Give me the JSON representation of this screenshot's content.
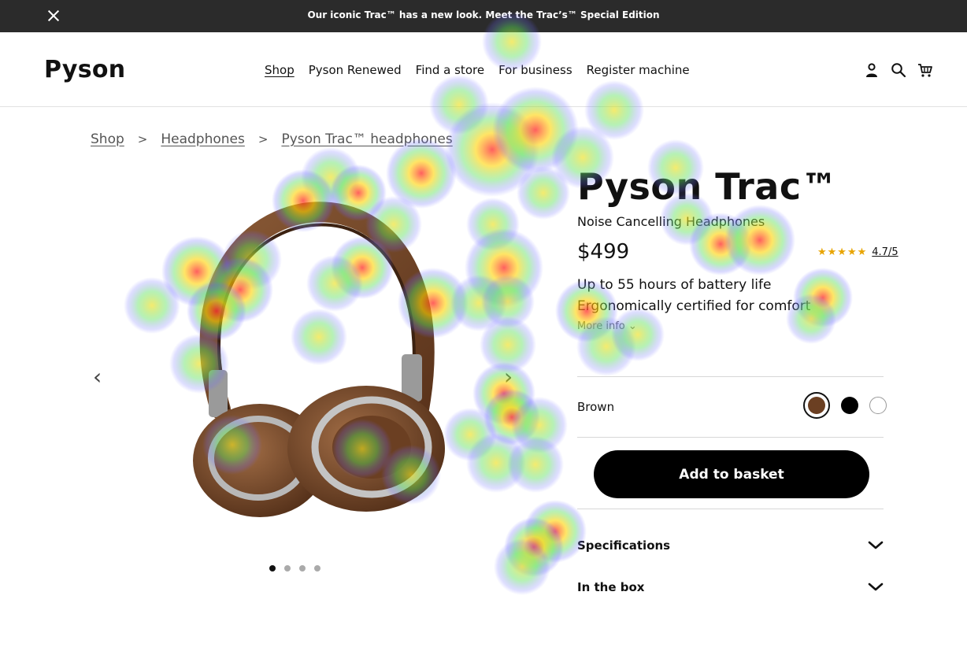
{
  "announcement": {
    "message": "Our iconic Trac™ has a new look. Meet the Trac’s™ Special Edition",
    "close_icon": "close-icon"
  },
  "header": {
    "logo": "Pyson",
    "nav": [
      "Shop",
      "Pyson Renewed",
      "Find a store",
      "For business",
      "Register machine"
    ],
    "icons": [
      "account-icon",
      "search-icon",
      "cart-icon"
    ]
  },
  "breadcrumb": [
    "Shop",
    "Headphones",
    "Pyson Trac™ headphones"
  ],
  "gallery": {
    "prev": "‹",
    "next": "›",
    "slide_count": 4,
    "active_slide": 1
  },
  "product": {
    "title": "Pyson Trac™",
    "subtitle": "Noise Cancelling Headphones",
    "price": "$499",
    "rating_stars": "★★★★★",
    "rating": "4.7/5",
    "features": [
      "Up to 55 hours of battery life",
      "Ergonomically certified for comfort"
    ],
    "more_info": "More info ⌄",
    "color_name": "Brown",
    "colors": [
      "#6b3f22",
      "#000000",
      "#ffffff"
    ],
    "selected_color": "#6b3f22",
    "add_to_basket": "Add to basket",
    "accordions": [
      "Specifications",
      "In the box"
    ]
  }
}
